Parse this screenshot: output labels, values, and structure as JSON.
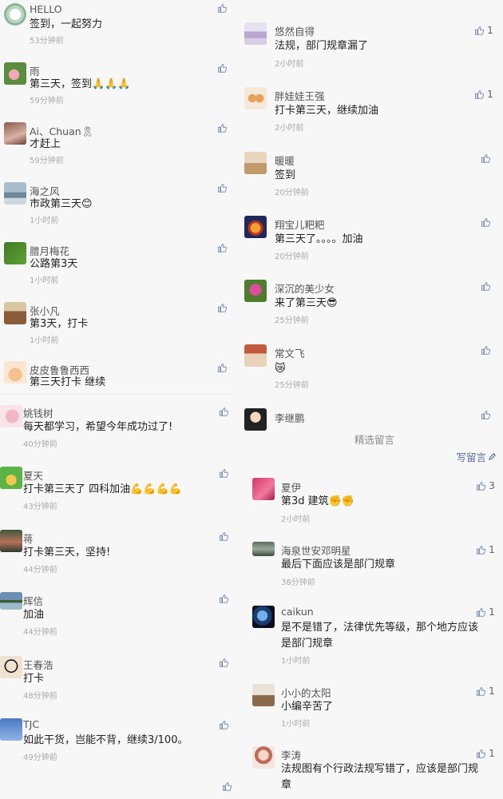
{
  "colors": {
    "link": "#576b95",
    "like_icon": "#7b8fb8",
    "background": "#f7f7f7"
  },
  "column_a": [
    {
      "name": "HELLO",
      "text": "签到，一起努力",
      "time": "53分钟前",
      "likes": "",
      "avatar": "flower-logo"
    },
    {
      "name": "雨",
      "text": "第三天，签到🙏🙏🙏",
      "time": "59分钟前",
      "likes": "",
      "avatar": "pink-flower"
    },
    {
      "name": "Ai、Chuan🎗",
      "text": "才赶上",
      "time": "59分钟前",
      "likes": "",
      "avatar": "portrait"
    },
    {
      "name": "海之风",
      "text": "市政第三天😊",
      "time": "1小时前",
      "likes": "",
      "avatar": "sea"
    },
    {
      "name": "腊月梅花",
      "text": "公路第3天",
      "time": "1小时前",
      "likes": "",
      "avatar": "green"
    },
    {
      "name": "张小凡",
      "text": "第3天，打卡",
      "time": "1小时前",
      "likes": "",
      "avatar": "room"
    },
    {
      "name": "皮皮鲁鲁西西",
      "text": "第三天打卡 继续",
      "time": "",
      "likes": "",
      "avatar": "cat"
    }
  ],
  "column_b": [
    {
      "name": "姚钱树",
      "text": "每天都学习，希望今年成功过了!",
      "time": "40分钟前",
      "likes": "",
      "avatar": "pink-girl"
    },
    {
      "name": "夏天",
      "text": "打卡第三天了 四科加油💪💪💪💪",
      "time": "43分钟前",
      "likes": "",
      "avatar": "cartoon"
    },
    {
      "name": "蒋",
      "text": "打卡第三天，坚持!",
      "time": "44分钟前",
      "likes": "",
      "avatar": "woman"
    },
    {
      "name": "辉信",
      "text": "加油",
      "time": "44分钟前",
      "likes": "",
      "avatar": "lake"
    },
    {
      "name": "王春浩",
      "text": "打卡",
      "time": "48分钟前",
      "likes": "",
      "avatar": "glasses"
    },
    {
      "name": "TJC",
      "text": "如此干货，岂能不背，继续3/100。",
      "time": "49分钟前",
      "likes": "",
      "avatar": "blue-sky"
    }
  ],
  "column_c": [
    {
      "name": "悠然自得",
      "text": "法规，部门规章漏了",
      "time": "2小时前",
      "likes": "1",
      "avatar": "castle"
    },
    {
      "name": "胖娃娃王强",
      "text": "打卡第三天，继续加油",
      "time": "2小时前",
      "likes": "1",
      "avatar": "dolls"
    },
    {
      "name": "暖暖",
      "text": "签到",
      "time": "20分钟前",
      "likes": "",
      "avatar": "sunset"
    },
    {
      "name": "翔宝儿粑粑",
      "text": "第三天了。。。。加油",
      "time": "20分钟前",
      "likes": "",
      "avatar": "rooster"
    },
    {
      "name": "深沉的美少女",
      "text": "来了第三天😎",
      "time": "25分钟前",
      "likes": "",
      "avatar": "lotus"
    },
    {
      "name": "常文飞",
      "text": "😿",
      "time": "25分钟前",
      "likes": "",
      "avatar": "temple"
    },
    {
      "name": "李继鹏",
      "text": "",
      "time": "",
      "likes": "",
      "avatar": "boy"
    }
  ],
  "featured": {
    "header": "精选留言",
    "write_label": "写留言",
    "items": [
      {
        "name": "夏伊",
        "text": "第3d 建筑✊✊",
        "time": "2小时前",
        "likes": "3",
        "avatar": "red-cloth"
      },
      {
        "name": "海泉世安邓明星",
        "text": "最后下面应该是部门规章",
        "time": "38分钟前",
        "likes": "1",
        "avatar": "landscape"
      },
      {
        "name": "caikun",
        "text": "是不是错了，法律优先等级，那个地方应该是部门规章",
        "time": "1小时前",
        "likes": "1",
        "avatar": "earth"
      },
      {
        "name": "小小的太阳",
        "text": "小编辛苦了",
        "time": "1小时前",
        "likes": "1",
        "avatar": "wall"
      },
      {
        "name": "李涛",
        "text": "法规图有个行政法规写错了，应该是部门规章",
        "time": "",
        "likes": "1",
        "avatar": "child"
      }
    ]
  }
}
